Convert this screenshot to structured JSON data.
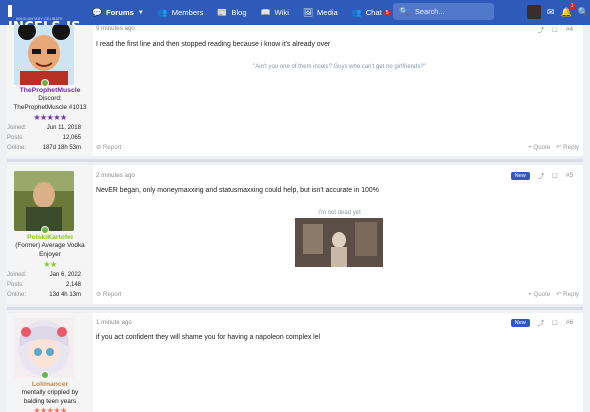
{
  "site": {
    "logo": "INCELS.IS",
    "tagline": "INVOLUNTARY CELIBATE"
  },
  "nav": {
    "items": [
      {
        "icon": "forums-icon",
        "label": "Forums"
      },
      {
        "icon": "members-icon",
        "label": "Members"
      },
      {
        "icon": "blog-icon",
        "label": "Blog"
      },
      {
        "icon": "wiki-icon",
        "label": "Wiki"
      },
      {
        "icon": "media-icon",
        "label": "Media"
      },
      {
        "icon": "chat-icon",
        "label": "Chat",
        "badge": "5"
      }
    ],
    "search_placeholder": "Search...",
    "alerts_badge": "1"
  },
  "colors": {
    "nav_bg": "#2e5bba",
    "accent": "#2e5bba",
    "online": "#63b54a",
    "user1_name": "#6b2fb3",
    "user1_stars": "#6b2fb3",
    "user2_name": "#8ac420",
    "user2_stars": "#8ac420",
    "user3_name": "#c08a54",
    "user3_stars": "#f0705a"
  },
  "posts": [
    {
      "username": "TheProphetMuscle",
      "usertitle": "Discord: TheProphetMuscle #1013",
      "stars": "★★★★★",
      "stats": [
        {
          "key": "Joined:",
          "value": "Jun 11, 2018"
        },
        {
          "key": "Posts:",
          "value": "12,065"
        },
        {
          "key": "Online:",
          "value": "187d 18h 53m"
        }
      ],
      "time": "9 minutes ago",
      "post_number": "#4",
      "message": "I read the first line and then stopped reading because i know it's already over",
      "signature": "\"Ain't you one of them incels? Guys who can't get no girlfriends?\"",
      "report": "Report",
      "quote": "Quote",
      "reply": "Reply"
    },
    {
      "username": "PolskiKartofel",
      "usertitle": "(Former) Average Vodka Enjoyer",
      "stars": "★★",
      "stats": [
        {
          "key": "Joined:",
          "value": "Jan 6, 2022"
        },
        {
          "key": "Posts:",
          "value": "2,148"
        },
        {
          "key": "Online:",
          "value": "13d 4h 13m"
        }
      ],
      "time": "2 minutes ago",
      "new_label": "New",
      "post_number": "#5",
      "message": "NevER began, only moneymaxxing and statusmaxxing could help, but isn't accurate in 100%",
      "signature": "I'm not dead yet",
      "report": "Report",
      "quote": "Quote",
      "reply": "Reply"
    },
    {
      "username": "Lolimancer",
      "usertitle": "mentally crippled by balding teen years",
      "stars": "★★★★★",
      "time": "1 minute ago",
      "new_label": "New",
      "post_number": "#6",
      "message": "if you act confident they will shame you for having a napoleon complex lel"
    }
  ]
}
